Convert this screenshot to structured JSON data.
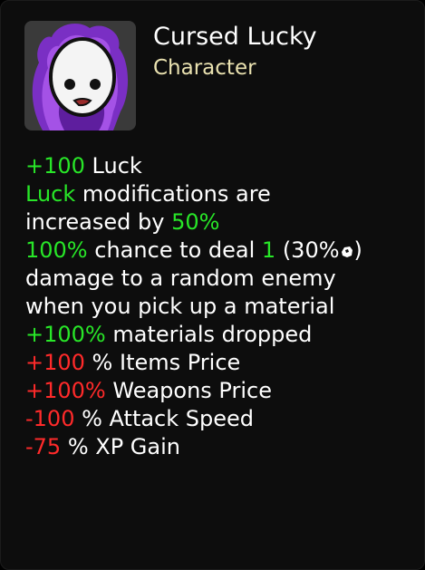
{
  "item": {
    "name": "Cursed Lucky",
    "category": "Character",
    "portrait_icon": "white-egg-face-purple-aura-icon",
    "material_icon": "material-icon"
  },
  "effects": [
    {
      "value": "+100",
      "text": " Luck"
    },
    {
      "keyword": "Luck",
      "text": " modifications are"
    },
    {
      "text": "increased by ",
      "value": "50%"
    },
    {
      "value": "100%",
      "text": " chance to deal ",
      "value2": "1",
      "text2": " (30%",
      "text3": ")"
    },
    {
      "text": "damage to a random enemy"
    },
    {
      "text": "when you pick up a material"
    },
    {
      "value": "+100%",
      "text": " materials dropped"
    },
    {
      "value": "+100",
      "text": " % Items Price"
    },
    {
      "value": "+100%",
      "text": " Weapons Price"
    },
    {
      "value": "-100",
      "text": " % Attack Speed"
    },
    {
      "value": "-75",
      "text": " % XP Gain"
    }
  ],
  "colors": {
    "background": "#0d0d0d",
    "title": "#ffffff",
    "category": "#eae2b0",
    "positive": "#28e628",
    "negative": "#ff2a2a",
    "portrait_bg": "#3a3a3a",
    "aura": "#8a2fd0"
  }
}
